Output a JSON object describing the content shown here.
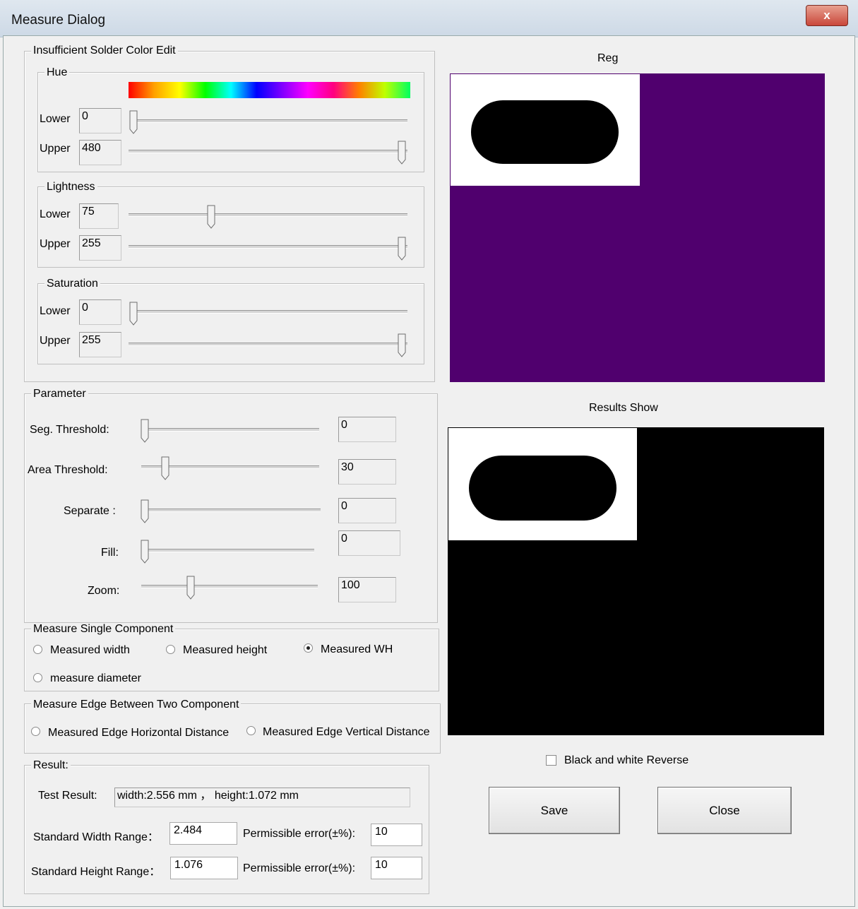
{
  "window": {
    "title": "Measure Dialog",
    "close_glyph": "x"
  },
  "color_edit": {
    "legend": "Insufficient Solder Color Edit",
    "hue": {
      "legend": "Hue",
      "lower_label": "Lower",
      "lower_value": "0",
      "upper_label": "Upper",
      "upper_value": "480",
      "lower_level": 0.0,
      "upper_level": 1.0
    },
    "lightness": {
      "legend": "Lightness",
      "lower_label": "Lower",
      "lower_value": "75",
      "upper_label": "Upper",
      "upper_value": "255",
      "lower_level": 0.29,
      "upper_level": 1.0
    },
    "saturation": {
      "legend": "Saturation",
      "lower_label": "Lower",
      "lower_value": "0",
      "upper_label": "Upper",
      "upper_value": "255",
      "lower_level": 0.0,
      "upper_level": 1.0
    }
  },
  "parameter": {
    "legend": "Parameter",
    "seg_threshold": {
      "label": "Seg. Threshold:",
      "value": "0",
      "level": 0.0
    },
    "area_threshold": {
      "label": "Area Threshold:",
      "value": "30",
      "level": 0.12
    },
    "separate": {
      "label": "Separate :",
      "value": "0",
      "level": 0.0
    },
    "fill": {
      "label": "Fill:",
      "value": "0",
      "level": 0.0
    },
    "zoom": {
      "label": "Zoom:",
      "value": "100",
      "level": 0.27
    }
  },
  "measure_single": {
    "legend": "Measure Single Component",
    "options": [
      "Measured width",
      "Measured height",
      "Measured WH",
      "measure diameter"
    ],
    "selected": "Measured WH"
  },
  "measure_edge": {
    "legend": "Measure Edge Between Two Component",
    "options": [
      "Measured Edge Horizontal Distance",
      "Measured Edge Vertical Distance"
    ]
  },
  "result": {
    "legend": "Result:",
    "test_label": "Test Result:",
    "test_value": "width:2.556 mm ， height:1.072 mm",
    "width_label": "Standard Width Range：",
    "width_value": "2.484",
    "height_label": "Standard Height Range：",
    "height_value": "1.076",
    "err_label": "Permissible error(±%):",
    "width_err": "10",
    "height_err": "10"
  },
  "reg": {
    "title": "Reg",
    "bg_color": "#50006e"
  },
  "results_show": {
    "title": "Results Show",
    "bg_color": "#000000"
  },
  "reverse": {
    "label": "Black and white Reverse",
    "checked": false
  },
  "buttons": {
    "save": "Save",
    "close": "Close"
  }
}
